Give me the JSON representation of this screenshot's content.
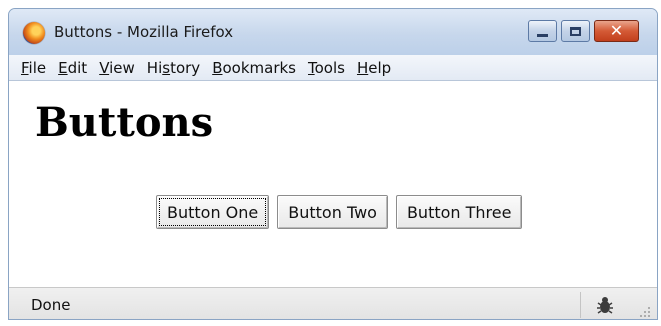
{
  "window": {
    "title": "Buttons - Mozilla Firefox",
    "controls": {
      "minimize": "minimize",
      "maximize": "maximize",
      "close": "close"
    }
  },
  "menubar": {
    "items": [
      {
        "label_u": "F",
        "label_rest": "ile"
      },
      {
        "label_u": "E",
        "label_rest": "dit"
      },
      {
        "label_u": "V",
        "label_rest": "iew"
      },
      {
        "label_pre": "Hi",
        "label_u": "s",
        "label_rest": "tory"
      },
      {
        "label_u": "B",
        "label_rest": "ookmarks"
      },
      {
        "label_u": "T",
        "label_rest": "ools"
      },
      {
        "label_u": "H",
        "label_rest": "elp"
      }
    ]
  },
  "page": {
    "heading": "Buttons",
    "buttons": [
      {
        "label": "Button One",
        "focused": true
      },
      {
        "label": "Button Two",
        "focused": false
      },
      {
        "label": "Button Three",
        "focused": false
      }
    ]
  },
  "status": {
    "text": "Done",
    "icon": "bug-icon"
  }
}
